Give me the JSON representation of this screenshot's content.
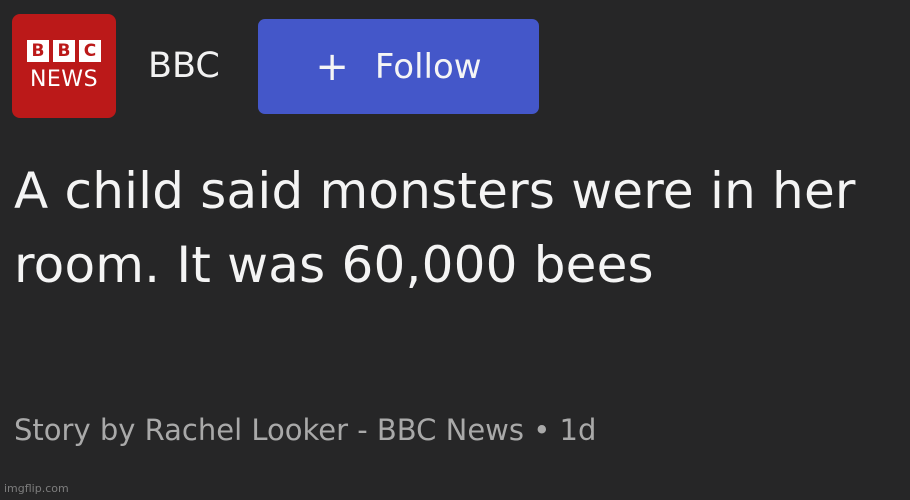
{
  "header": {
    "logo": {
      "letters": [
        "B",
        "B",
        "C"
      ],
      "label": "NEWS",
      "color": "#bb1919"
    },
    "publisher_name": "BBC",
    "follow_button": {
      "icon": "plus-icon",
      "icon_glyph": "+",
      "label": "Follow",
      "color": "#4457c9"
    }
  },
  "article": {
    "headline": "A child said monsters were in her room. It was 60,000 bees",
    "byline": "Story by Rachel Looker - BBC News • 1d"
  },
  "watermark": "imgflip.com"
}
